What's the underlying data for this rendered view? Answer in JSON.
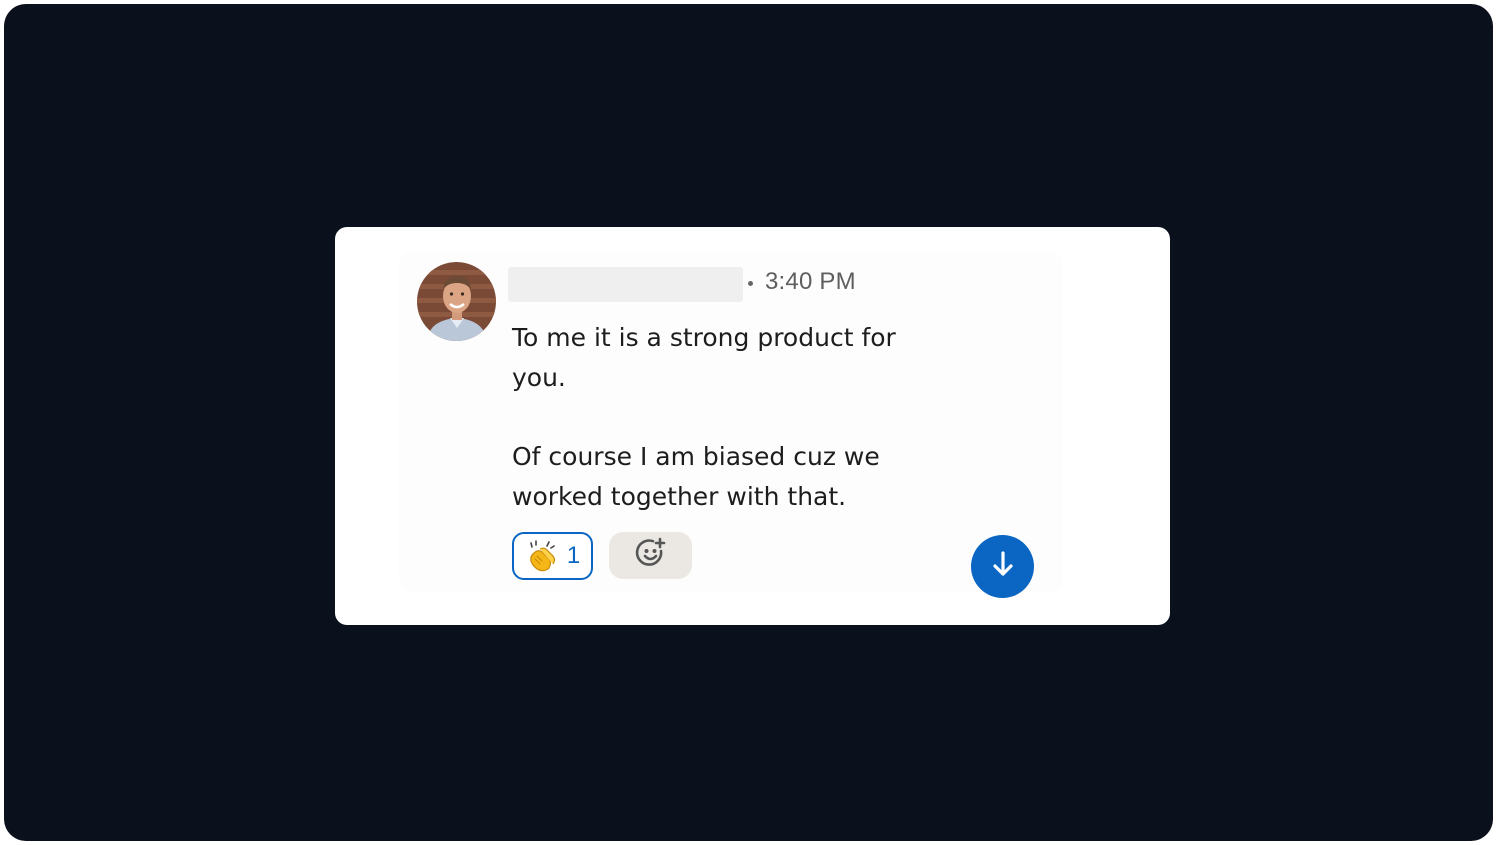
{
  "message": {
    "timestamp": "3:40 PM",
    "paragraphs": [
      "To me it is a strong product for you.",
      "Of course I am biased cuz we worked together with that."
    ],
    "reactions": [
      {
        "emoji": "clapping-hands",
        "count": "1",
        "selected": true
      }
    ],
    "add_reaction_icon": "add-emoji-icon"
  },
  "scroll_button_icon": "arrow-down-icon",
  "colors": {
    "accent": "#0a66c2",
    "background": "#0b111c",
    "card": "#ffffff"
  }
}
